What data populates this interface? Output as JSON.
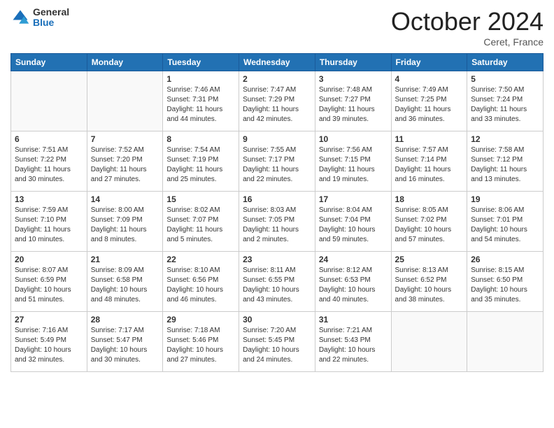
{
  "header": {
    "logo_general": "General",
    "logo_blue": "Blue",
    "month_title": "October 2024",
    "location": "Ceret, France"
  },
  "days_of_week": [
    "Sunday",
    "Monday",
    "Tuesday",
    "Wednesday",
    "Thursday",
    "Friday",
    "Saturday"
  ],
  "weeks": [
    [
      {
        "day": "",
        "info": ""
      },
      {
        "day": "",
        "info": ""
      },
      {
        "day": "1",
        "info": "Sunrise: 7:46 AM\nSunset: 7:31 PM\nDaylight: 11 hours and 44 minutes."
      },
      {
        "day": "2",
        "info": "Sunrise: 7:47 AM\nSunset: 7:29 PM\nDaylight: 11 hours and 42 minutes."
      },
      {
        "day": "3",
        "info": "Sunrise: 7:48 AM\nSunset: 7:27 PM\nDaylight: 11 hours and 39 minutes."
      },
      {
        "day": "4",
        "info": "Sunrise: 7:49 AM\nSunset: 7:25 PM\nDaylight: 11 hours and 36 minutes."
      },
      {
        "day": "5",
        "info": "Sunrise: 7:50 AM\nSunset: 7:24 PM\nDaylight: 11 hours and 33 minutes."
      }
    ],
    [
      {
        "day": "6",
        "info": "Sunrise: 7:51 AM\nSunset: 7:22 PM\nDaylight: 11 hours and 30 minutes."
      },
      {
        "day": "7",
        "info": "Sunrise: 7:52 AM\nSunset: 7:20 PM\nDaylight: 11 hours and 27 minutes."
      },
      {
        "day": "8",
        "info": "Sunrise: 7:54 AM\nSunset: 7:19 PM\nDaylight: 11 hours and 25 minutes."
      },
      {
        "day": "9",
        "info": "Sunrise: 7:55 AM\nSunset: 7:17 PM\nDaylight: 11 hours and 22 minutes."
      },
      {
        "day": "10",
        "info": "Sunrise: 7:56 AM\nSunset: 7:15 PM\nDaylight: 11 hours and 19 minutes."
      },
      {
        "day": "11",
        "info": "Sunrise: 7:57 AM\nSunset: 7:14 PM\nDaylight: 11 hours and 16 minutes."
      },
      {
        "day": "12",
        "info": "Sunrise: 7:58 AM\nSunset: 7:12 PM\nDaylight: 11 hours and 13 minutes."
      }
    ],
    [
      {
        "day": "13",
        "info": "Sunrise: 7:59 AM\nSunset: 7:10 PM\nDaylight: 11 hours and 10 minutes."
      },
      {
        "day": "14",
        "info": "Sunrise: 8:00 AM\nSunset: 7:09 PM\nDaylight: 11 hours and 8 minutes."
      },
      {
        "day": "15",
        "info": "Sunrise: 8:02 AM\nSunset: 7:07 PM\nDaylight: 11 hours and 5 minutes."
      },
      {
        "day": "16",
        "info": "Sunrise: 8:03 AM\nSunset: 7:05 PM\nDaylight: 11 hours and 2 minutes."
      },
      {
        "day": "17",
        "info": "Sunrise: 8:04 AM\nSunset: 7:04 PM\nDaylight: 10 hours and 59 minutes."
      },
      {
        "day": "18",
        "info": "Sunrise: 8:05 AM\nSunset: 7:02 PM\nDaylight: 10 hours and 57 minutes."
      },
      {
        "day": "19",
        "info": "Sunrise: 8:06 AM\nSunset: 7:01 PM\nDaylight: 10 hours and 54 minutes."
      }
    ],
    [
      {
        "day": "20",
        "info": "Sunrise: 8:07 AM\nSunset: 6:59 PM\nDaylight: 10 hours and 51 minutes."
      },
      {
        "day": "21",
        "info": "Sunrise: 8:09 AM\nSunset: 6:58 PM\nDaylight: 10 hours and 48 minutes."
      },
      {
        "day": "22",
        "info": "Sunrise: 8:10 AM\nSunset: 6:56 PM\nDaylight: 10 hours and 46 minutes."
      },
      {
        "day": "23",
        "info": "Sunrise: 8:11 AM\nSunset: 6:55 PM\nDaylight: 10 hours and 43 minutes."
      },
      {
        "day": "24",
        "info": "Sunrise: 8:12 AM\nSunset: 6:53 PM\nDaylight: 10 hours and 40 minutes."
      },
      {
        "day": "25",
        "info": "Sunrise: 8:13 AM\nSunset: 6:52 PM\nDaylight: 10 hours and 38 minutes."
      },
      {
        "day": "26",
        "info": "Sunrise: 8:15 AM\nSunset: 6:50 PM\nDaylight: 10 hours and 35 minutes."
      }
    ],
    [
      {
        "day": "27",
        "info": "Sunrise: 7:16 AM\nSunset: 5:49 PM\nDaylight: 10 hours and 32 minutes."
      },
      {
        "day": "28",
        "info": "Sunrise: 7:17 AM\nSunset: 5:47 PM\nDaylight: 10 hours and 30 minutes."
      },
      {
        "day": "29",
        "info": "Sunrise: 7:18 AM\nSunset: 5:46 PM\nDaylight: 10 hours and 27 minutes."
      },
      {
        "day": "30",
        "info": "Sunrise: 7:20 AM\nSunset: 5:45 PM\nDaylight: 10 hours and 24 minutes."
      },
      {
        "day": "31",
        "info": "Sunrise: 7:21 AM\nSunset: 5:43 PM\nDaylight: 10 hours and 22 minutes."
      },
      {
        "day": "",
        "info": ""
      },
      {
        "day": "",
        "info": ""
      }
    ]
  ]
}
